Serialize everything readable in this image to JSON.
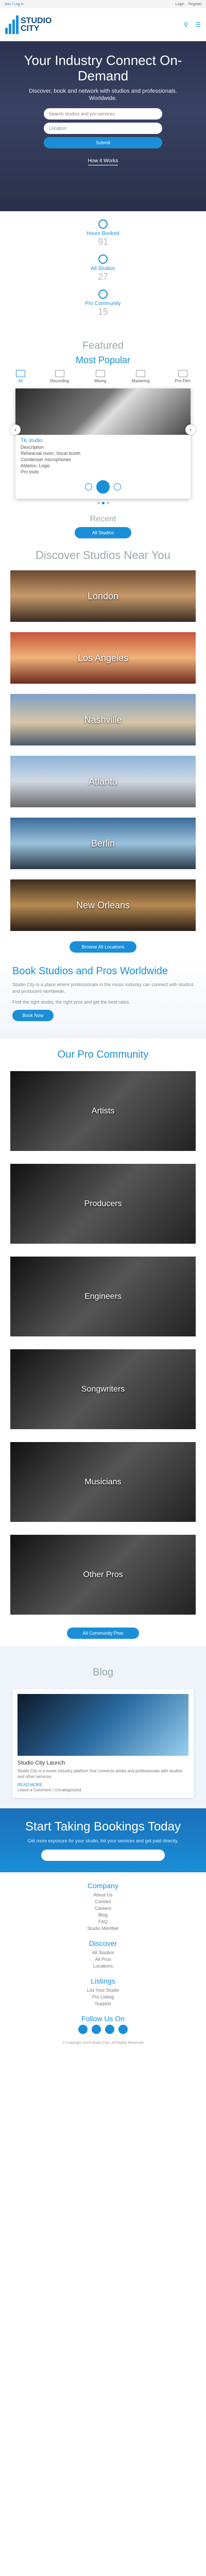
{
  "topbar": {
    "left": "Join / Log in",
    "right1": "Login",
    "right2": "Register"
  },
  "header": {
    "logo_line1": "STUDIO",
    "logo_line2": "CITY",
    "menu_label": "MENU",
    "search_icon": "search-icon"
  },
  "hero": {
    "title": "Your Industry Connect On-Demand",
    "subtitle": "Discover, book and network with studios and professionals. Worldwide.",
    "field1_placeholder": "Search studios and pro services",
    "field2_placeholder": "Location",
    "submit_label": "Submit",
    "how_label": "How it Works"
  },
  "stats": [
    {
      "label": "Hours Booked",
      "value": "91"
    },
    {
      "label": "All Studios",
      "value": "27"
    },
    {
      "label": "Pro Community",
      "value": "15"
    }
  ],
  "featured": {
    "title": "Featured",
    "subtitle": "Most Popular",
    "tabs": [
      "All",
      "Recording",
      "Mixing",
      "Mastering",
      "Pro Film"
    ],
    "card": {
      "name": "TK studio",
      "lines": [
        "Description",
        "Rehearsal room, Vocal booth",
        "Condenser microphones",
        "Ableton, Logic",
        "Pro tools"
      ],
      "price": "Price/hr"
    },
    "recent_label": "Recent",
    "all_label": "All Studios"
  },
  "discover": {
    "title": "Discover Studios Near You",
    "cities": [
      "London",
      "Los Angeles",
      "Nashville",
      "Atlanta",
      "Berlin",
      "New Orleans"
    ],
    "button": "Browse All Locations"
  },
  "book": {
    "title": "Book Studios and Pros Worldwide",
    "p1": "Studio City is a place where professionals in the music industry can connect with studios and producers worldwide.",
    "p2": "Find the right studio, the right pros and get the best rates.",
    "button": "Book Now"
  },
  "community": {
    "title": "Our Pro Community",
    "items": [
      "Artists",
      "Producers",
      "Engineers",
      "Songwriters",
      "Musicians",
      "Other Pros"
    ],
    "button": "All Community Pros"
  },
  "blog": {
    "title": "Blog",
    "post_title": "Studio City Launch",
    "post_desc": "Studio City is a music industry platform that connects artists and professionals with studios and other services.",
    "read_more": "READ MORE",
    "post_meta": "Leave a Comment / Uncategorized"
  },
  "cta": {
    "title": "Start Taking Bookings Today",
    "text": "Get more exposure for your studio, list your services and get paid directly.",
    "button": "List Your Space"
  },
  "footer": {
    "sections": [
      {
        "title": "Company",
        "items": [
          "About Us",
          "Contact",
          "Careers",
          "Blog",
          "FAQ",
          "Studio Member"
        ]
      },
      {
        "title": "Discover",
        "items": [
          "All Studios",
          "All Pros",
          "Locations"
        ]
      },
      {
        "title": "Listings",
        "items": [
          "List Your Studio",
          "Pro Listing",
          "Support"
        ]
      }
    ],
    "follow": "Follow Us On",
    "copyright": "© Copyright 2019 Studio City | All Rights Reserved"
  }
}
